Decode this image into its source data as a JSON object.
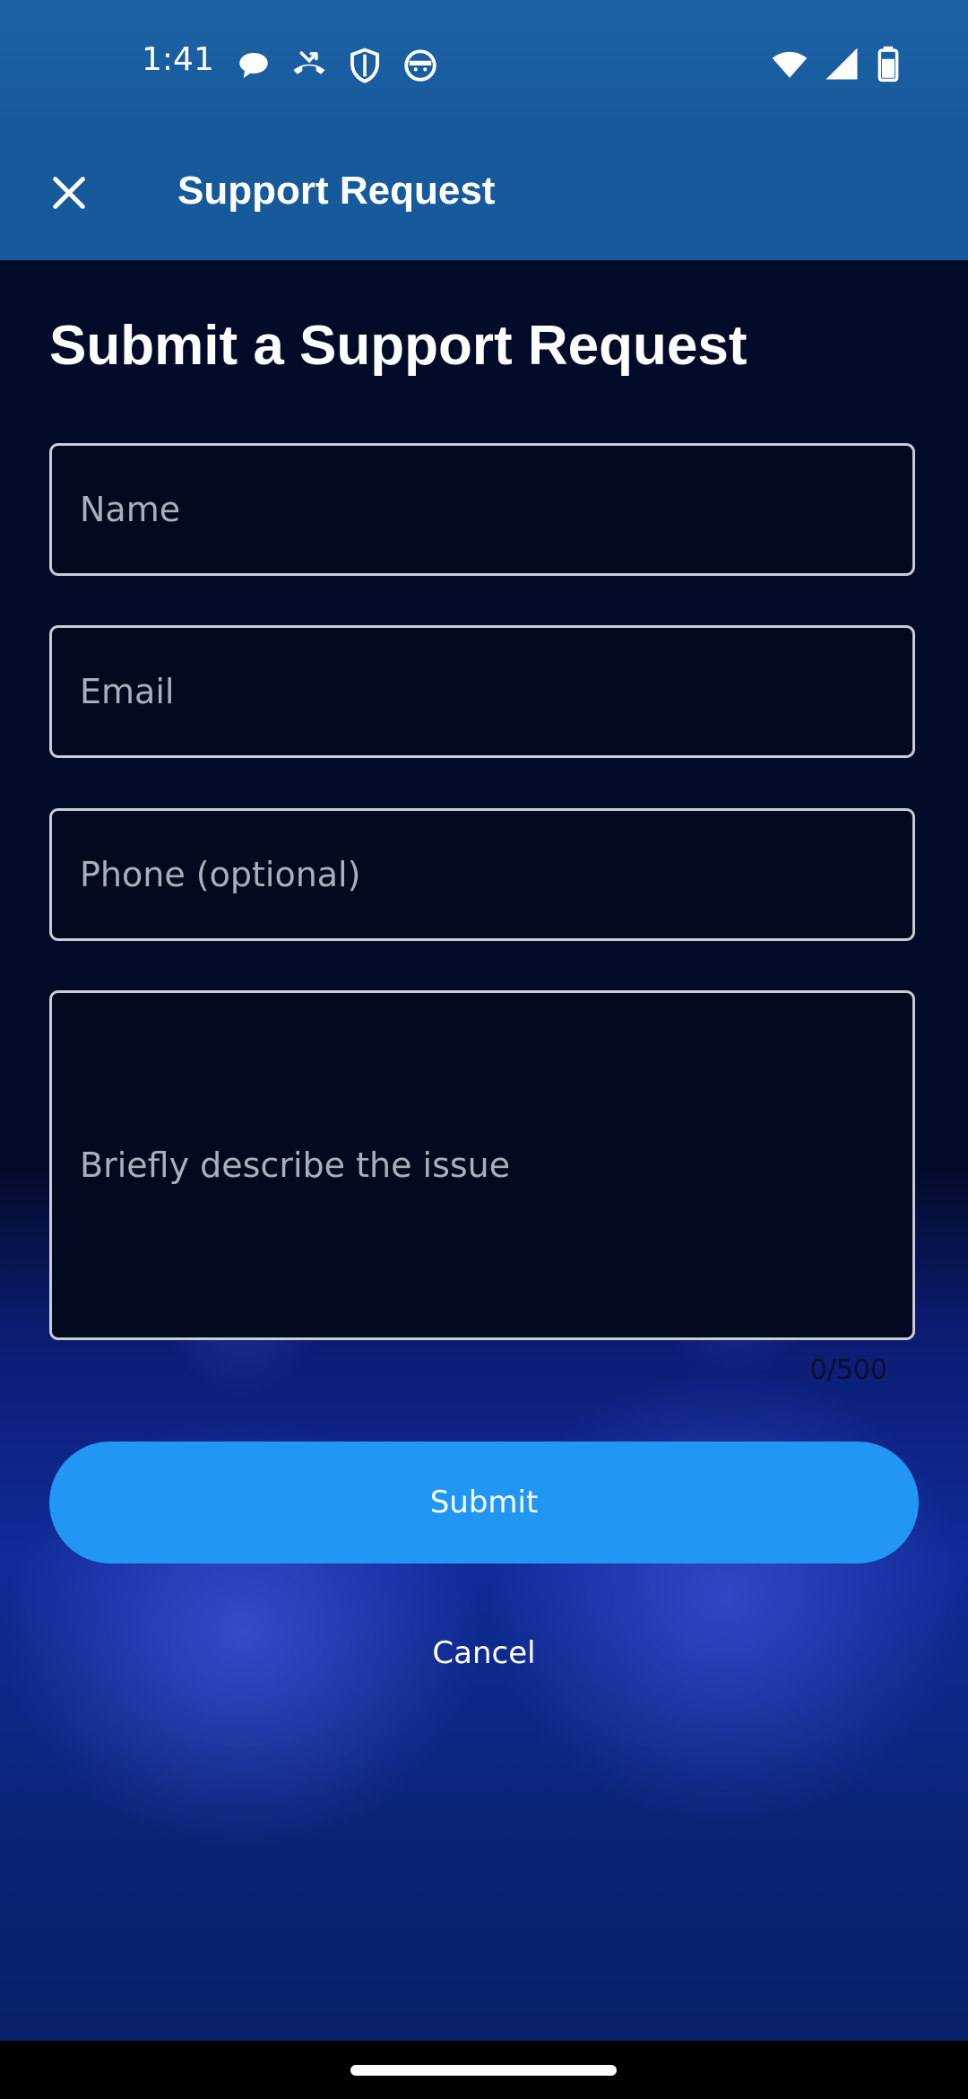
{
  "status_bar": {
    "time": "1:41",
    "left_icons": [
      "chat-bubble-icon",
      "missed-call-icon",
      "shield-icon",
      "cat-face-icon"
    ],
    "right_icons": [
      "wifi-icon",
      "cellular-signal-icon",
      "battery-icon"
    ]
  },
  "app_bar": {
    "close_icon": "close-icon",
    "title": "Support Request"
  },
  "form": {
    "heading": "Submit a Support Request",
    "name_placeholder": "Name",
    "email_placeholder": "Email",
    "phone_placeholder": "Phone (optional)",
    "description_placeholder": "Briefly describe the issue",
    "char_counter": "0/500",
    "submit_label": "Submit",
    "cancel_label": "Cancel"
  },
  "colors": {
    "app_bar": "#175a9b",
    "background": "#020b28",
    "submit_button": "#2196f3"
  }
}
